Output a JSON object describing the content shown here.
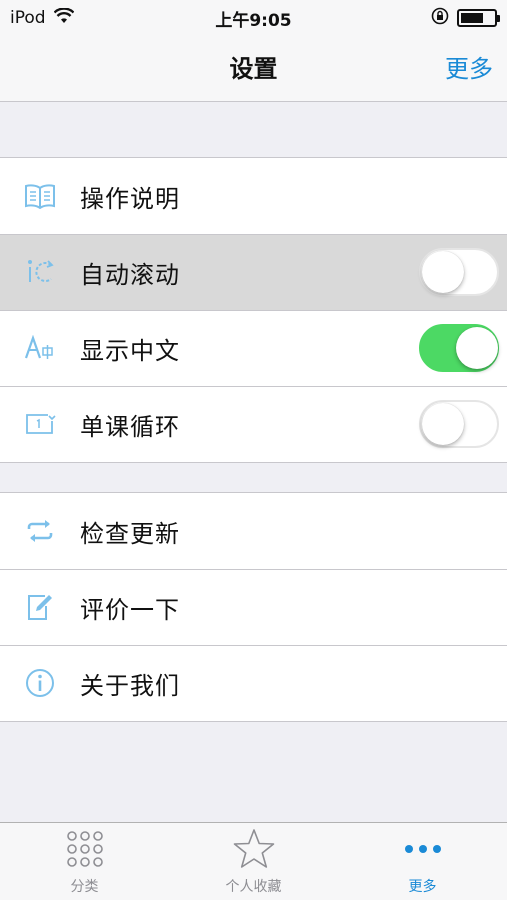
{
  "status_bar": {
    "carrier": "iPod",
    "time": "上午9:05"
  },
  "nav": {
    "title": "设置",
    "more": "更多"
  },
  "settings_group_1": [
    {
      "label": "操作说明",
      "icon": "book-icon"
    },
    {
      "label": "自动滚动",
      "icon": "auto-scroll-icon",
      "toggle": false,
      "highlighted": true
    },
    {
      "label": "显示中文",
      "icon": "chinese-font-icon",
      "toggle": true
    },
    {
      "label": "单课循环",
      "icon": "repeat-one-icon",
      "toggle": false
    }
  ],
  "settings_group_2": [
    {
      "label": "检查更新",
      "icon": "refresh-arrows-icon"
    },
    {
      "label": "评价一下",
      "icon": "edit-pen-icon"
    },
    {
      "label": "关于我们",
      "icon": "info-icon"
    }
  ],
  "tabbar": [
    {
      "label": "分类",
      "icon": "grid-dots-icon",
      "active": false
    },
    {
      "label": "个人收藏",
      "icon": "star-icon",
      "active": false
    },
    {
      "label": "更多",
      "icon": "more-dots-icon",
      "active": true
    }
  ],
  "colors": {
    "accent": "#1a8ad6",
    "icon": "#7cc0ea",
    "toggle_on": "#4cd964"
  }
}
